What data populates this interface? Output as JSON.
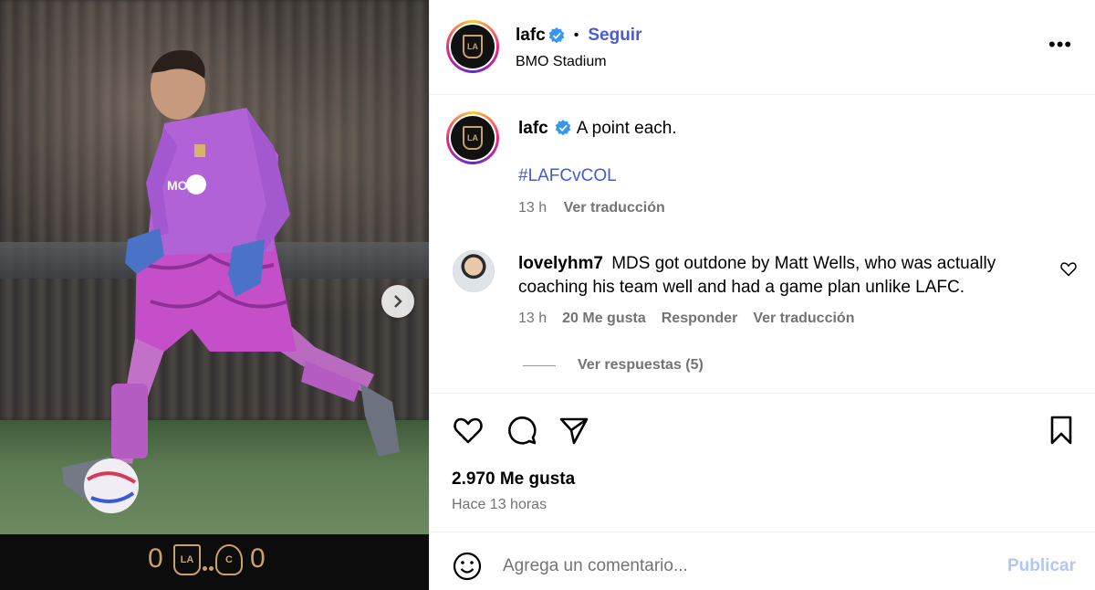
{
  "media": {
    "score_home": "0",
    "score_away": "0",
    "crest_home": "LAFC",
    "crest_away": "COL",
    "next_icon": "chevron-right-icon"
  },
  "header": {
    "username": "lafc",
    "separator": "•",
    "follow_label": "Seguir",
    "location": "BMO Stadium",
    "more_label": "•••"
  },
  "caption": {
    "username": "lafc",
    "text": "A point each.",
    "hashtag": "#LAFCvCOL",
    "time": "13 h",
    "translate": "Ver traducción"
  },
  "comment": {
    "username": "lovelyhm7",
    "text": "MDS got outdone by Matt Wells, who was actually coaching his team well and had a game plan unlike LAFC.",
    "time": "13 h",
    "likes": "20 Me gusta",
    "reply": "Responder",
    "translate": "Ver traducción",
    "view_replies": "Ver respuestas (5)"
  },
  "footer": {
    "likes": "2.970 Me gusta",
    "time_ago": "Hace 13 horas",
    "comment_placeholder": "Agrega un comentario...",
    "publish": "Publicar"
  },
  "colors": {
    "link_blue": "#4a5bd7",
    "publish_disabled": "#b2c6f5",
    "meta_gray": "#737373",
    "gold": "#c8a26a"
  }
}
